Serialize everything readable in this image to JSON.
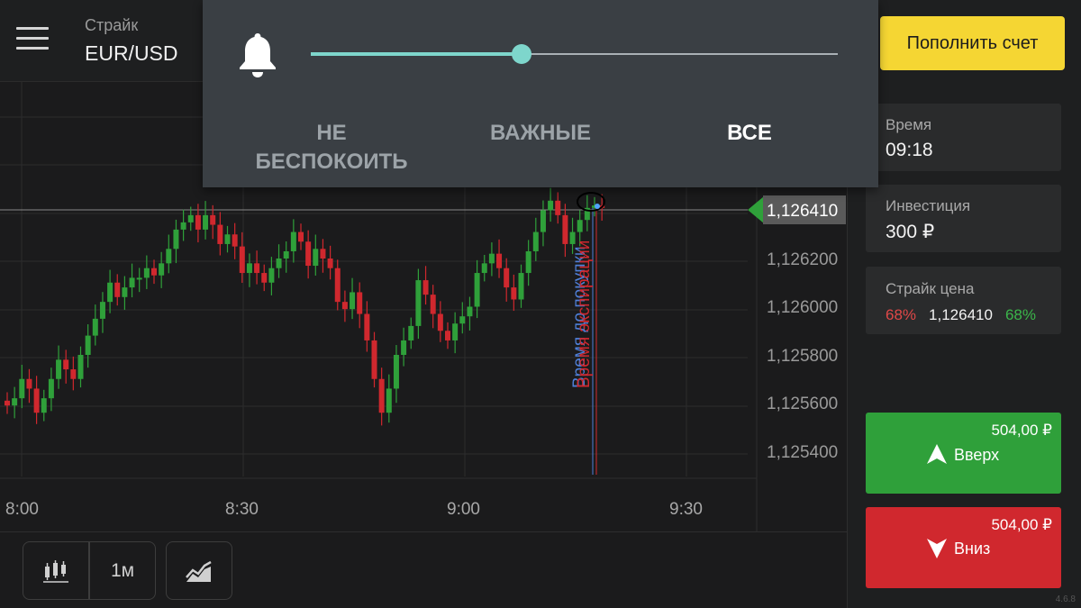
{
  "header": {
    "menu_icon": "hamburger-menu-icon",
    "asset_label": "Страйк",
    "asset_name": "EUR/USD"
  },
  "notifications": {
    "bell_icon": "bell-icon",
    "level_fraction": 0.4,
    "options": [
      {
        "label": "НЕ\nБЕСПОКОИТЬ",
        "active": false
      },
      {
        "label": "ВАЖНЫЕ",
        "active": false
      },
      {
        "label": "ВСЕ",
        "active": true
      }
    ]
  },
  "right_panel": {
    "deposit_label": "Пополнить счет",
    "time": {
      "label": "Время",
      "value": "09:18"
    },
    "investment": {
      "label": "Инвестиция",
      "value": "300 ₽"
    },
    "strike": {
      "label": "Страйк цена",
      "pct_down": "68%",
      "price": "1,126410",
      "pct_up": "68%"
    },
    "up": {
      "amount": "504,00 ₽",
      "label": "Вверх",
      "icon": "arrow-up-icon",
      "color": "#2fa03a"
    },
    "down": {
      "amount": "504,00 ₽",
      "label": "Вниз",
      "icon": "arrow-down-icon",
      "color": "#d0282e"
    },
    "version": "4.6.8"
  },
  "toolbar": {
    "candles_icon": "candlestick-icon",
    "timeframe": "1м",
    "indicator_icon": "trend-line-icon"
  },
  "chart_data": {
    "type": "candlestick",
    "current_price": "1,126410",
    "y_ticks": [
      "1,126200",
      "1,126000",
      "1,125800",
      "1,125600",
      "1,125400"
    ],
    "x_ticks": [
      "8:00",
      "8:30",
      "9:00",
      "9:30"
    ],
    "expiry_label": "Время экспирации",
    "purchase_label": "Время до покупки",
    "colors": {
      "up": "#2fa03a",
      "down": "#d0282e",
      "marker": "#2fa03a"
    },
    "closes": [
      1.12559,
      1.12562,
      1.1257,
      1.12566,
      1.12556,
      1.12562,
      1.1257,
      1.12578,
      1.12574,
      1.1257,
      1.1258,
      1.12588,
      1.12595,
      1.12602,
      1.1261,
      1.12604,
      1.12608,
      1.12612,
      1.12612,
      1.12616,
      1.12613,
      1.12618,
      1.12624,
      1.12632,
      1.12635,
      1.12638,
      1.12632,
      1.12638,
      1.12634,
      1.12626,
      1.1263,
      1.12625,
      1.12614,
      1.12618,
      1.12614,
      1.1261,
      1.12616,
      1.1262,
      1.12623,
      1.12631,
      1.12627,
      1.12617,
      1.12624,
      1.1262,
      1.12616,
      1.12602,
      1.12599,
      1.12606,
      1.12597,
      1.12586,
      1.1257,
      1.12556,
      1.12566,
      1.1258,
      1.12586,
      1.12592,
      1.12611,
      1.12605,
      1.12597,
      1.1259,
      1.12586,
      1.12593,
      1.12596,
      1.126,
      1.12614,
      1.12618,
      1.12622,
      1.12616,
      1.12608,
      1.12603,
      1.12614,
      1.12623,
      1.12631,
      1.1264,
      1.12644,
      1.12638,
      1.12626,
      1.12631,
      1.12636,
      1.12641,
      1.12642,
      1.12641
    ]
  }
}
